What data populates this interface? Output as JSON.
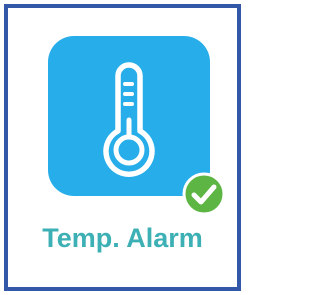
{
  "app_tile": {
    "label": "Temp. Alarm",
    "icon": "thermometer-icon",
    "badge_icon": "checkmark-icon",
    "status": "installed",
    "colors": {
      "frame_border": "#3358a8",
      "tile_background": "#27aeea",
      "icon_stroke": "#ffffff",
      "badge_fill": "#5db543",
      "label_text": "#3cb0b4"
    }
  }
}
